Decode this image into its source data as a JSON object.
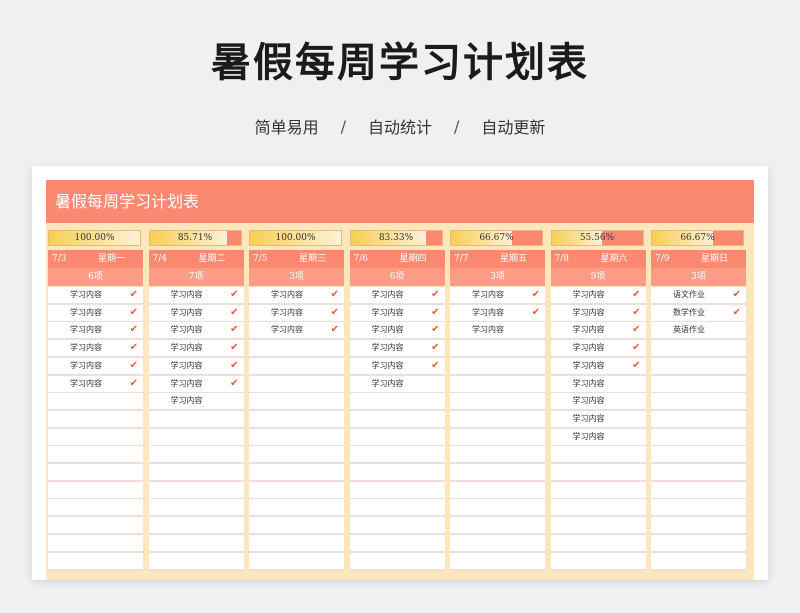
{
  "title": "暑假每周学习计划表",
  "subtitle": {
    "items": [
      "简单易用",
      "自动统计",
      "自动更新"
    ],
    "separator": "/"
  },
  "sheet": {
    "header_title": "暑假每周学习计划表",
    "colors": {
      "header": "#fb8870",
      "count_row": "#fc9c86",
      "column_bg": "#fce7bd",
      "check": "#ee5a3c",
      "progress_fill": "#f7cf52"
    },
    "days": [
      {
        "progress": 1.0,
        "progress_label": "100.00%",
        "date": "7/3",
        "weekday": "星期一",
        "count": "6项",
        "tasks": [
          {
            "label": "学习内容",
            "done": true
          },
          {
            "label": "学习内容",
            "done": true
          },
          {
            "label": "学习内容",
            "done": true
          },
          {
            "label": "学习内容",
            "done": true
          },
          {
            "label": "学习内容",
            "done": true
          },
          {
            "label": "学习内容",
            "done": true
          }
        ]
      },
      {
        "progress": 0.8571,
        "progress_label": "85.71%",
        "date": "7/4",
        "weekday": "星期二",
        "count": "7项",
        "tasks": [
          {
            "label": "学习内容",
            "done": true
          },
          {
            "label": "学习内容",
            "done": true
          },
          {
            "label": "学习内容",
            "done": true
          },
          {
            "label": "学习内容",
            "done": true
          },
          {
            "label": "学习内容",
            "done": true
          },
          {
            "label": "学习内容",
            "done": true
          },
          {
            "label": "学习内容",
            "done": false
          }
        ]
      },
      {
        "progress": 1.0,
        "progress_label": "100.00%",
        "date": "7/5",
        "weekday": "星期三",
        "count": "3项",
        "tasks": [
          {
            "label": "学习内容",
            "done": true
          },
          {
            "label": "学习内容",
            "done": true
          },
          {
            "label": "学习内容",
            "done": true
          }
        ]
      },
      {
        "progress": 0.8333,
        "progress_label": "83.33%",
        "date": "7/6",
        "weekday": "星期四",
        "count": "6项",
        "tasks": [
          {
            "label": "学习内容",
            "done": true
          },
          {
            "label": "学习内容",
            "done": true
          },
          {
            "label": "学习内容",
            "done": true
          },
          {
            "label": "学习内容",
            "done": true
          },
          {
            "label": "学习内容",
            "done": true
          },
          {
            "label": "学习内容",
            "done": false
          }
        ]
      },
      {
        "progress": 0.6667,
        "progress_label": "66.67%",
        "date": "7/7",
        "weekday": "星期五",
        "count": "3项",
        "tasks": [
          {
            "label": "学习内容",
            "done": true
          },
          {
            "label": "学习内容",
            "done": true
          },
          {
            "label": "学习内容",
            "done": false
          }
        ]
      },
      {
        "progress": 0.5556,
        "progress_label": "55.56%",
        "date": "7/8",
        "weekday": "星期六",
        "count": "9项",
        "tasks": [
          {
            "label": "学习内容",
            "done": true
          },
          {
            "label": "学习内容",
            "done": true
          },
          {
            "label": "学习内容",
            "done": true
          },
          {
            "label": "学习内容",
            "done": true
          },
          {
            "label": "学习内容",
            "done": true
          },
          {
            "label": "学习内容",
            "done": false
          },
          {
            "label": "学习内容",
            "done": false
          },
          {
            "label": "学习内容",
            "done": false
          },
          {
            "label": "学习内容",
            "done": false
          }
        ]
      },
      {
        "progress": 0.6667,
        "progress_label": "66.67%",
        "date": "7/9",
        "weekday": "星期日",
        "count": "3项",
        "tasks": [
          {
            "label": "语文作业",
            "done": true
          },
          {
            "label": "数学作业",
            "done": true
          },
          {
            "label": "英语作业",
            "done": false
          }
        ]
      }
    ],
    "check_glyph": "✔"
  }
}
